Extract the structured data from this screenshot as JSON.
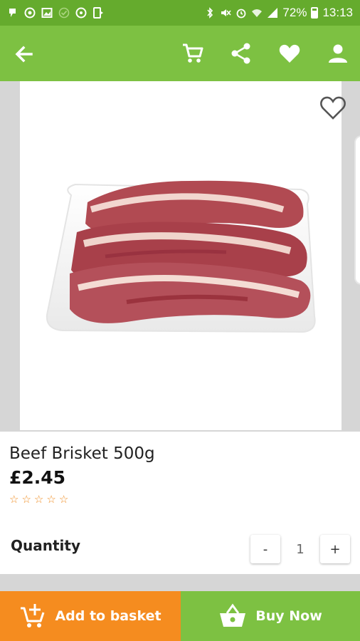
{
  "status_bar": {
    "battery": "72%",
    "time": "13:13",
    "left_icons": [
      "notification-icon",
      "whatsapp-icon",
      "gallery-icon",
      "check-icon",
      "sync-icon",
      "tablet-icon"
    ],
    "right_icons": [
      "bluetooth-icon",
      "mute-icon",
      "alarm-icon",
      "wifi-icon",
      "signal-icon",
      "battery-icon"
    ]
  },
  "app_bar": {
    "back_icon": "arrow-back-icon",
    "actions": [
      "cart-icon",
      "share-icon",
      "heart-icon",
      "person-icon"
    ],
    "color": "#7dc142"
  },
  "product": {
    "name": "Beef Brisket 500g",
    "price": "£2.45",
    "rating": 0,
    "rating_max": 5,
    "quantity_label": "Quantity",
    "quantity": "1",
    "minus": "-",
    "plus": "+"
  },
  "bottom_bar": {
    "add_label": "Add to basket",
    "buy_label": "Buy Now",
    "add_color": "#f58c1f",
    "buy_color": "#7dc142"
  }
}
